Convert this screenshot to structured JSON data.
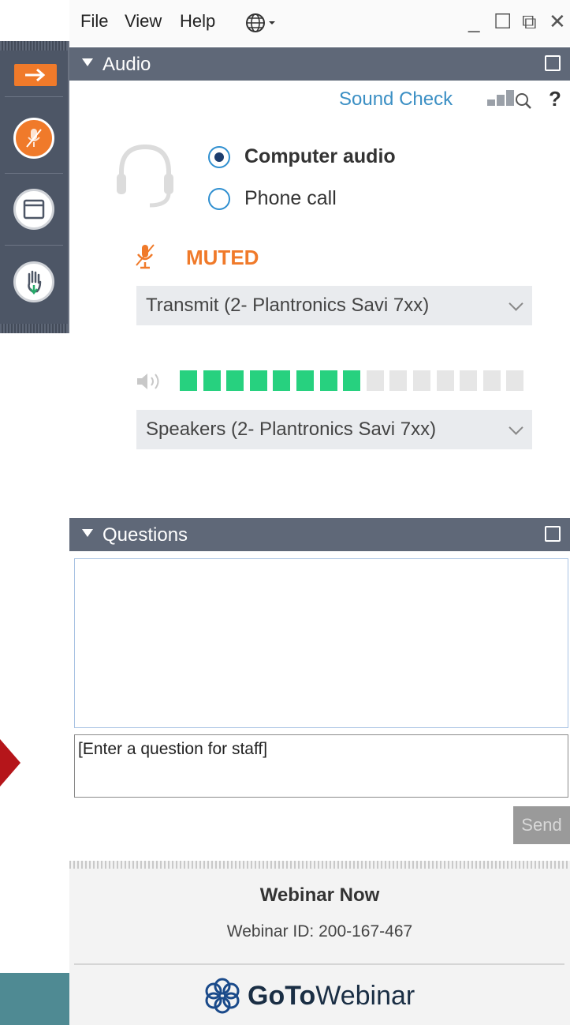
{
  "menu": {
    "file": "File",
    "view": "View",
    "help": "Help"
  },
  "window_controls": {
    "minimize": "_",
    "restore": "☐",
    "popout": "⧉",
    "close": "✕"
  },
  "audio": {
    "title": "Audio",
    "sound_check": "Sound Check",
    "help": "?",
    "options": [
      {
        "label": "Computer audio",
        "selected": true
      },
      {
        "label": "Phone call",
        "selected": false
      }
    ],
    "status": "MUTED",
    "microphone": "Transmit (2- Plantronics Savi 7xx)",
    "speakers": "Speakers (2- Plantronics Savi 7xx)",
    "level": {
      "active": 8,
      "total": 15
    }
  },
  "questions": {
    "title": "Questions",
    "placeholder": "[Enter a question for staff]",
    "send": "Send"
  },
  "footer": {
    "webinar_name": "Webinar Now",
    "webinar_id": "Webinar ID: 200-167-467",
    "brand_goto": "GoTo",
    "brand_webinar": "Webinar"
  },
  "colors": {
    "accent_orange": "#f07a2a",
    "link_blue": "#3b8fc4",
    "header_gray": "#5f6878",
    "meter_green": "#27d17f",
    "meter_off": "#e6e6e6"
  }
}
